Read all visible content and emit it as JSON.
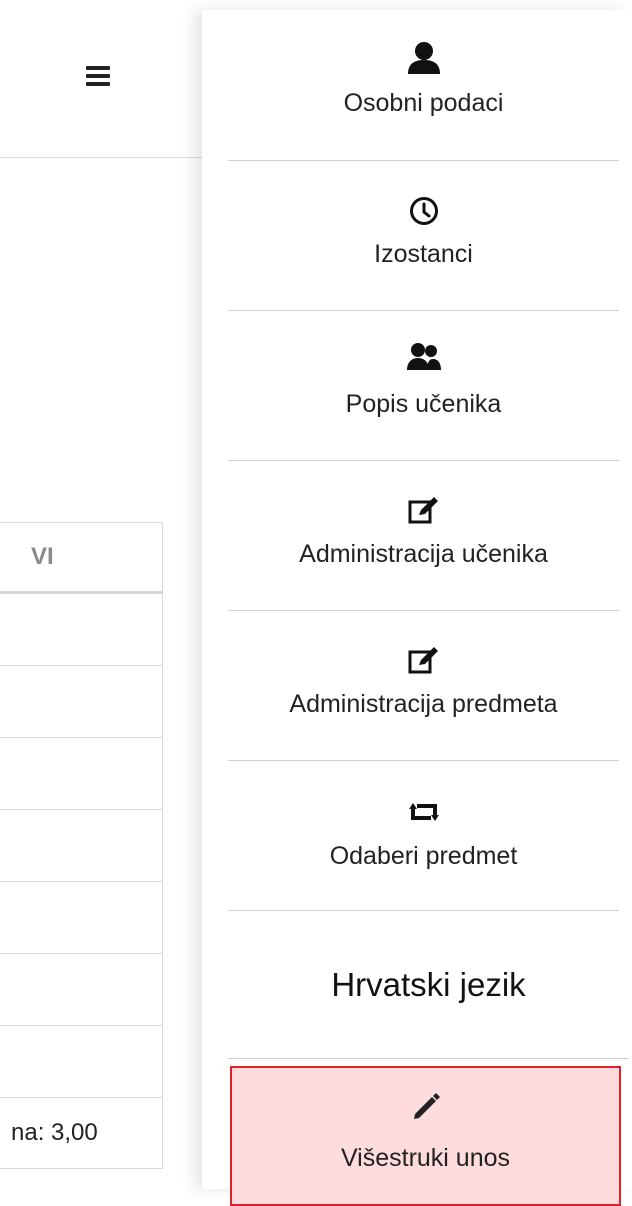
{
  "menu": {
    "items": [
      {
        "label": "Osobni podaci",
        "icon": "user-icon"
      },
      {
        "label": "Izostanci",
        "icon": "clock-icon"
      },
      {
        "label": "Popis učenika",
        "icon": "users-icon"
      },
      {
        "label": "Administracija učenika",
        "icon": "edit-icon"
      },
      {
        "label": "Administracija predmeta",
        "icon": "edit-icon"
      },
      {
        "label": "Odaberi predmet",
        "icon": "retweet-icon"
      }
    ],
    "subject": "Hrvatski jezik",
    "active": {
      "label": "Višestruki unos",
      "icon": "pencil-icon"
    }
  },
  "table": {
    "column_header": "VI",
    "average_text": "na: 3,00"
  },
  "colors": {
    "active_bg": "#fedbdc",
    "active_border": "#e0202b"
  }
}
